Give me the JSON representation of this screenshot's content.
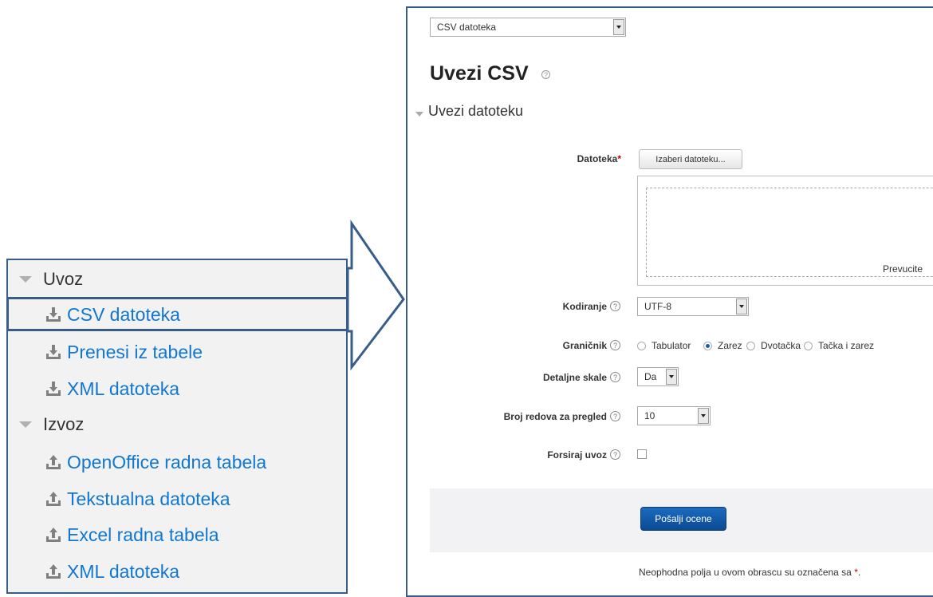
{
  "left_nav": {
    "sections": [
      {
        "title": "Uvoz",
        "items": [
          {
            "label": "CSV datoteka",
            "icon": "import-icon"
          },
          {
            "label": "Prenesi iz tabele",
            "icon": "import-icon"
          },
          {
            "label": "XML datoteka",
            "icon": "import-icon"
          }
        ]
      },
      {
        "title": "Izvoz",
        "items": [
          {
            "label": "OpenOffice radna tabela",
            "icon": "export-icon"
          },
          {
            "label": "Tekstualna datoteka",
            "icon": "export-icon"
          },
          {
            "label": "Excel radna tabela",
            "icon": "export-icon"
          },
          {
            "label": "XML datoteka",
            "icon": "export-icon"
          }
        ]
      }
    ]
  },
  "form": {
    "import_type_select": "CSV datoteka",
    "heading": "Uvezi CSV",
    "section_title": "Uvezi datoteku",
    "file_label": "Datoteka",
    "required_mark": "*",
    "choose_file_button": "Izaberi datoteku...",
    "drop_hint": "Prevucite",
    "encoding_label": "Kodiranje",
    "encoding_value": "UTF-8",
    "separator_label": "Graničnik",
    "separator_options": [
      "Tabulator",
      "Zarez",
      "Dvotačka",
      "Tačka i zarez"
    ],
    "separator_selected": "Zarez",
    "verbose_scales_label": "Detaljne skale",
    "verbose_scales_value": "Da",
    "preview_rows_label": "Broj redova za pregled",
    "preview_rows_value": "10",
    "force_import_label": "Forsiraj uvoz",
    "force_import_checked": false,
    "submit_button": "Pošalji ocene",
    "required_note": "Neophodna polja u ovom obrascu su označena sa"
  },
  "colors": {
    "link": "#1177d1",
    "frame": "#385d8a",
    "primary_button": "#0b4a92",
    "required": "#c00000"
  }
}
